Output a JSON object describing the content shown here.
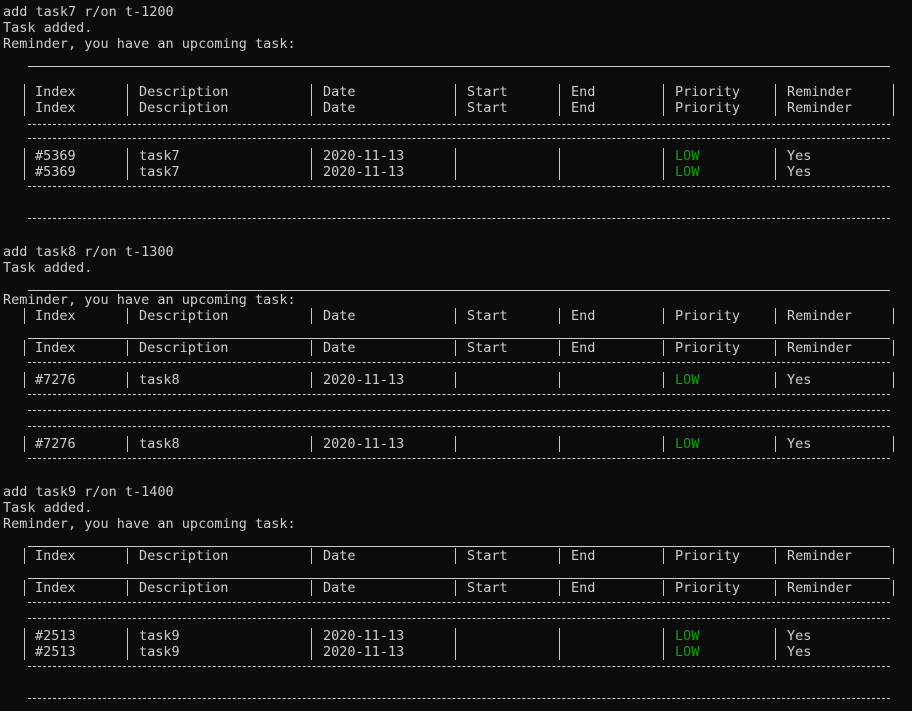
{
  "colors": {
    "background": "#0c0c0c",
    "text": "#cccccc",
    "priority_low": "#13a10e"
  },
  "header": {
    "index": "Index",
    "description": "Description",
    "date": "Date",
    "start": "Start",
    "end": "End",
    "priority": "Priority",
    "reminder": "Reminder"
  },
  "lines": {
    "cmd1": "add task7 r/on t-1200",
    "added1": "Task added.",
    "remind1": "Reminder, you have an upcoming task:",
    "cmd2": "add task8 r/on t-1300",
    "added2": "Task added.",
    "remind2": "Reminder, you have an upcoming task:",
    "cmd3": "add task9 r/on t-1400",
    "added3": "Task added.",
    "remind3": "Reminder, you have an upcoming task:"
  },
  "tasks": {
    "t7": {
      "index": "#5369",
      "description": "task7",
      "date": "2020-11-13",
      "priority": "LOW",
      "reminder": "Yes"
    },
    "t8": {
      "index": "#7276",
      "description": "task8",
      "date": "2020-11-13",
      "priority": "LOW",
      "reminder": "Yes"
    },
    "t9": {
      "index": "#2513",
      "description": "task9",
      "date": "2020-11-13",
      "priority": "LOW",
      "reminder": "Yes"
    }
  }
}
